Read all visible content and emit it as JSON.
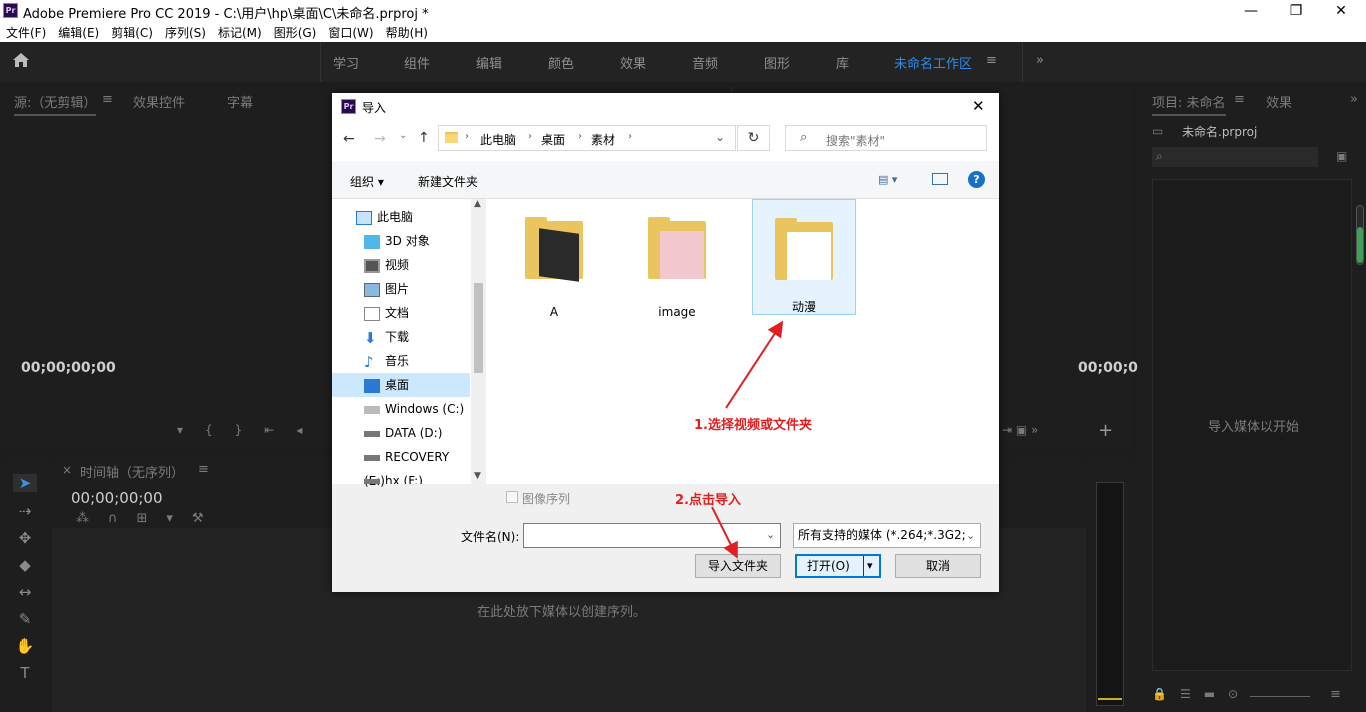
{
  "window": {
    "title": "Adobe Premiere Pro CC 2019 - C:\\用户\\hp\\桌面\\C\\未命名.prproj *",
    "logo": "Pr",
    "minimize": "—",
    "restore": "❐",
    "close": "✕"
  },
  "menu": [
    "文件(F)",
    "编辑(E)",
    "剪辑(C)",
    "序列(S)",
    "标记(M)",
    "图形(G)",
    "窗口(W)",
    "帮助(H)"
  ],
  "workspaces": {
    "items": [
      "学习",
      "组件",
      "编辑",
      "颜色",
      "效果",
      "音频",
      "图形",
      "库"
    ],
    "active": "未命名工作区",
    "menu_icon": "≡",
    "more": "»"
  },
  "source_panel": {
    "tabs": [
      "源:（无剪辑）",
      "效果控件",
      "字幕"
    ],
    "timecode_left": "00;00;00;00",
    "timecode_right": "00;00;0"
  },
  "timeline_panel": {
    "close": "×",
    "tab": "时间轴（无序列）",
    "timecode": "00;00;00;00",
    "drop_hint": "在此处放下媒体以创建序列。"
  },
  "project_panel": {
    "tab": "项目: 未命名",
    "tab2": "效果",
    "file": "未命名.prproj",
    "empty_hint": "导入媒体以开始"
  },
  "dialog": {
    "logo": "Pr",
    "title": "导入",
    "close": "✕",
    "breadcrumb": [
      "此电脑",
      "桌面",
      "素材"
    ],
    "search_placeholder": "搜索\"素材\"",
    "organize": "组织",
    "new_folder": "新建文件夹",
    "help": "?",
    "nav": [
      "此电脑",
      "3D 对象",
      "视频",
      "图片",
      "文档",
      "下载",
      "音乐",
      "桌面",
      "Windows (C:)",
      "DATA (D:)",
      "RECOVERY (E:)",
      "hx (F:)"
    ],
    "nav_selected": "桌面",
    "files": [
      "A",
      "image",
      "动漫"
    ],
    "image_sequence": "图像序列",
    "filename_label": "文件名(N):",
    "filename_value": "",
    "filter": "所有支持的媒体 (*.264;*.3G2;*",
    "import_folder": "导入文件夹",
    "open": "打开(O)",
    "cancel": "取消"
  },
  "annotations": {
    "step1": "1.选择视频或文件夹",
    "step2": "2.点击导入"
  },
  "colors": {
    "accent": "#2d8ceb",
    "annotation": "#e02020",
    "panel_bg": "#1e1e1e"
  }
}
